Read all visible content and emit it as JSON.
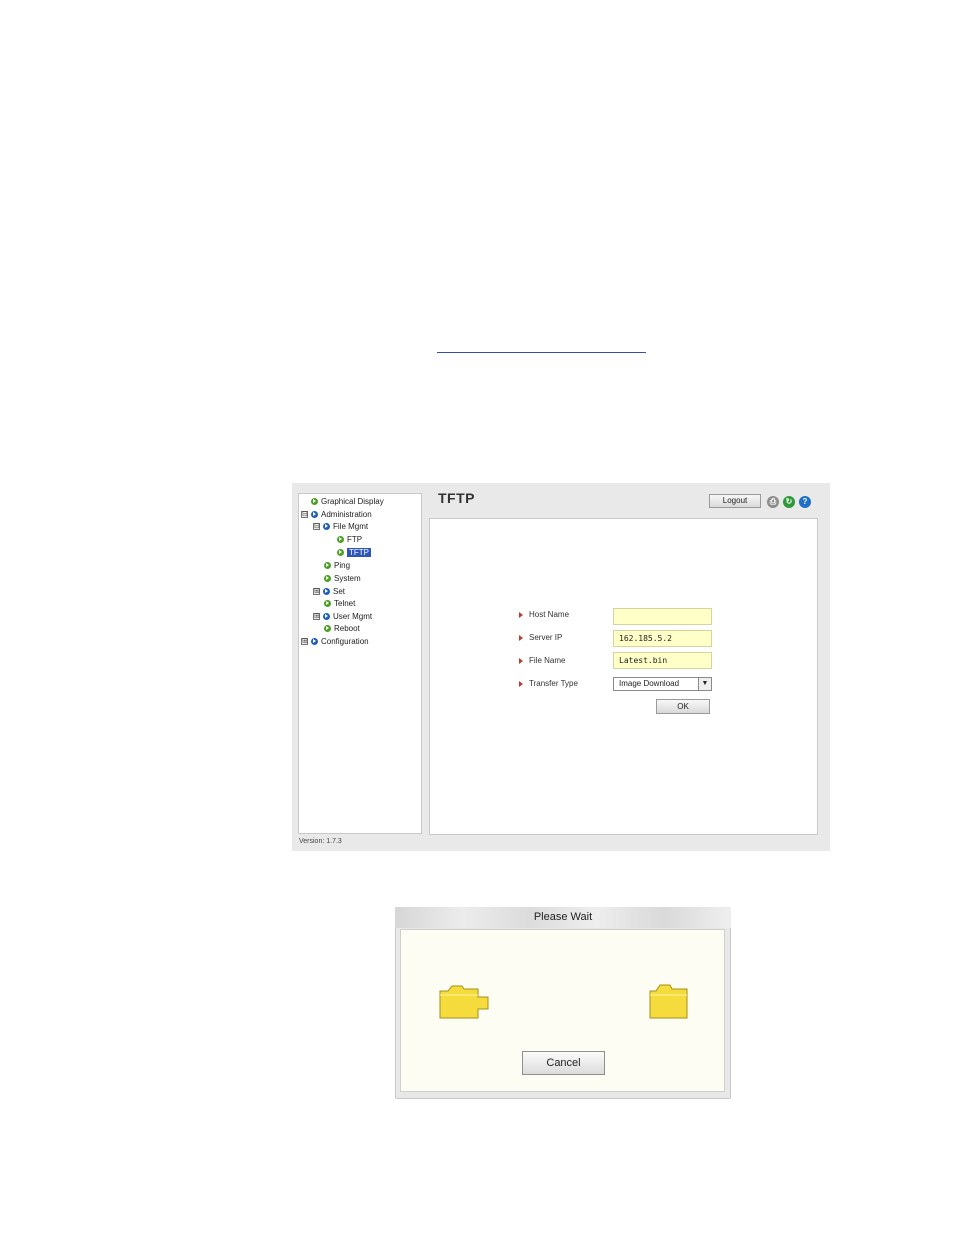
{
  "tree": {
    "items": [
      {
        "label": "Graphical Display"
      },
      {
        "label": "Administration"
      },
      {
        "label": "File Mgmt"
      },
      {
        "label": "FTP"
      },
      {
        "label": "TFTP"
      },
      {
        "label": "Ping"
      },
      {
        "label": "System"
      },
      {
        "label": "Set"
      },
      {
        "label": "Telnet"
      },
      {
        "label": "User Mgmt"
      },
      {
        "label": "Reboot"
      },
      {
        "label": "Configuration"
      }
    ],
    "expand_symbol": "⊞",
    "collapse_symbol": "⊟"
  },
  "header": {
    "title": "TFTP",
    "logout_label": "Logout",
    "icons": [
      "print-icon",
      "refresh-icon",
      "help-icon"
    ]
  },
  "form": {
    "host_name": {
      "label": "Host Name",
      "value": ""
    },
    "server_ip": {
      "label": "Server IP",
      "value": "162.185.5.2"
    },
    "file_name": {
      "label": "File Name",
      "value": "Latest.bin"
    },
    "transfer_type": {
      "label": "Transfer Type",
      "value": "Image Download"
    },
    "ok_label": "OK"
  },
  "version": "Version: 1.7.3",
  "dialog": {
    "title": "Please Wait",
    "cancel_label": "Cancel",
    "icons": [
      "source-folder-icon",
      "destination-folder-icon"
    ]
  },
  "colors": {
    "selected_bg": "#2f55b8",
    "input_bg": "#ffffc8",
    "folder_yellow": "#f5dc3c",
    "bullet_blue": "#1f5fb8",
    "bullet_green": "#4aa020"
  }
}
